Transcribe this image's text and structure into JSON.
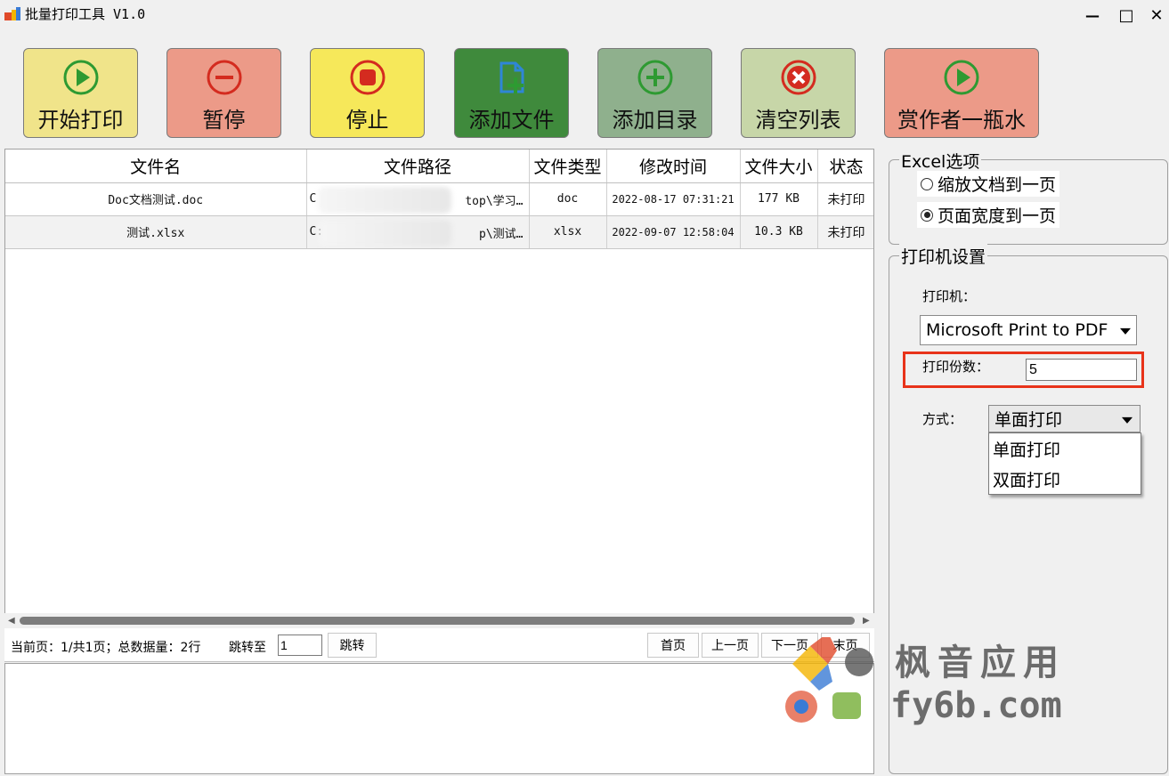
{
  "window": {
    "title": "批量打印工具 V1.0",
    "minimize": "—",
    "maximize": "□",
    "close": "✕"
  },
  "toolbar": [
    {
      "label": "开始打印",
      "icon": "play-icon",
      "bg": "#f0e48a",
      "icon_color": "#2e9a32"
    },
    {
      "label": "暂停",
      "icon": "minus-circle-icon",
      "bg": "#ec9a88",
      "icon_color": "#d42b1f"
    },
    {
      "label": "停止",
      "icon": "stop-icon",
      "bg": "#f6e85a",
      "icon_color": "#d42b1f"
    },
    {
      "label": "添加文件",
      "icon": "add-file-icon",
      "bg": "#3f8a3c",
      "icon_color": "#2f86d6"
    },
    {
      "label": "添加目录",
      "icon": "plus-circle-icon",
      "bg": "#8fb08d",
      "icon_color": "#2e9a32"
    },
    {
      "label": "清空列表",
      "icon": "x-circle-icon",
      "bg": "#c7d6a8",
      "icon_color": "#d42b1f"
    },
    {
      "label": "赏作者一瓶水",
      "icon": "play-icon",
      "bg": "#ec9a88",
      "icon_color": "#2e9a32"
    }
  ],
  "table": {
    "headers": [
      "文件名",
      "文件路径",
      "文件类型",
      "修改时间",
      "文件大小",
      "状态"
    ],
    "rows": [
      {
        "name": "Doc文档测试.doc",
        "path_start": "C",
        "path_end": "top\\学习…",
        "type": "doc",
        "modified": "2022-08-17 07:31:21",
        "size": "177 KB",
        "status": "未打印"
      },
      {
        "name": "测试.xlsx",
        "path_start": "C:",
        "path_end": "p\\测试…",
        "type": "xlsx",
        "modified": "2022-09-07 12:58:04",
        "size": "10.3 KB",
        "status": "未打印"
      }
    ]
  },
  "pager": {
    "info": "当前页：1/共1页；总数据量：2行",
    "jump_label": "跳转至",
    "jump_value": "1",
    "jump_button": "跳转",
    "first": "首页",
    "prev": "上一页",
    "next": "下一页",
    "last": "末页"
  },
  "excel_options": {
    "title": "Excel选项",
    "options": [
      {
        "label": "缩放文档到一页",
        "selected": false
      },
      {
        "label": "页面宽度到一页",
        "selected": true
      }
    ]
  },
  "printer_settings": {
    "title": "打印机设置",
    "printer_label": "打印机：",
    "printer_value": "Microsoft Print to PDF",
    "copies_label": "打印份数：",
    "copies_value": "5",
    "mode_label": "方式：",
    "mode_value": "单面打印",
    "mode_options": [
      "单面打印",
      "双面打印"
    ]
  },
  "watermark": {
    "line1": "枫音应用",
    "line2": "fy6b.com"
  },
  "colors": {
    "highlight": "#e8331a",
    "scroll_thumb": "#7d7d7d"
  }
}
